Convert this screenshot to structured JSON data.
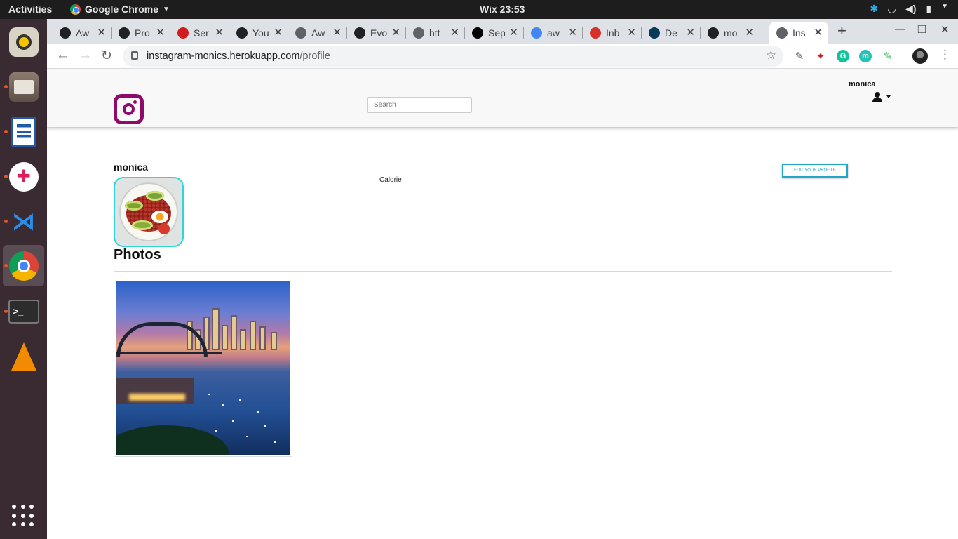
{
  "os": {
    "activities": "Activities",
    "app_name": "Google Chrome",
    "clock": "Wix 23:53",
    "dock_items": [
      "rhythmbox-icon",
      "files-icon",
      "writer-icon",
      "slack-icon",
      "vscode-icon",
      "chrome-icon",
      "terminal-icon",
      "vlc-icon"
    ]
  },
  "browser": {
    "tabs": [
      {
        "title": "Aw",
        "icon": "github-icon",
        "color": "#202124"
      },
      {
        "title": "Pro",
        "icon": "github-icon",
        "color": "#202124"
      },
      {
        "title": "Ser",
        "icon": "red-dots-icon",
        "color": "#d01c1c"
      },
      {
        "title": "You",
        "icon": "github-icon",
        "color": "#202124"
      },
      {
        "title": "Aw",
        "icon": "globe-icon",
        "color": "#5f6368"
      },
      {
        "title": "Evo",
        "icon": "github-icon",
        "color": "#202124"
      },
      {
        "title": "htt",
        "icon": "globe-icon",
        "color": "#5f6368"
      },
      {
        "title": "Sep",
        "icon": "medium-icon",
        "color": "#000000"
      },
      {
        "title": "aw",
        "icon": "google-icon",
        "color": "#4285f4"
      },
      {
        "title": "Inb",
        "icon": "gmail-icon",
        "color": "#d93025"
      },
      {
        "title": "De",
        "icon": "dev-d-icon",
        "color": "#0a3a5a"
      },
      {
        "title": "mo",
        "icon": "github-icon",
        "color": "#202124"
      },
      {
        "title": "Ins",
        "icon": "globe-icon",
        "color": "#5f6368",
        "active": true
      }
    ],
    "url_host": "instagram-monics.herokuapp.com",
    "url_path": "/profile"
  },
  "page": {
    "search_placeholder": "Search",
    "nav_username": "monica",
    "profile_name": "monica",
    "bio": "Calorie",
    "edit_label": "EDIT YOUR PROFILE",
    "photos_title": "Photos"
  }
}
